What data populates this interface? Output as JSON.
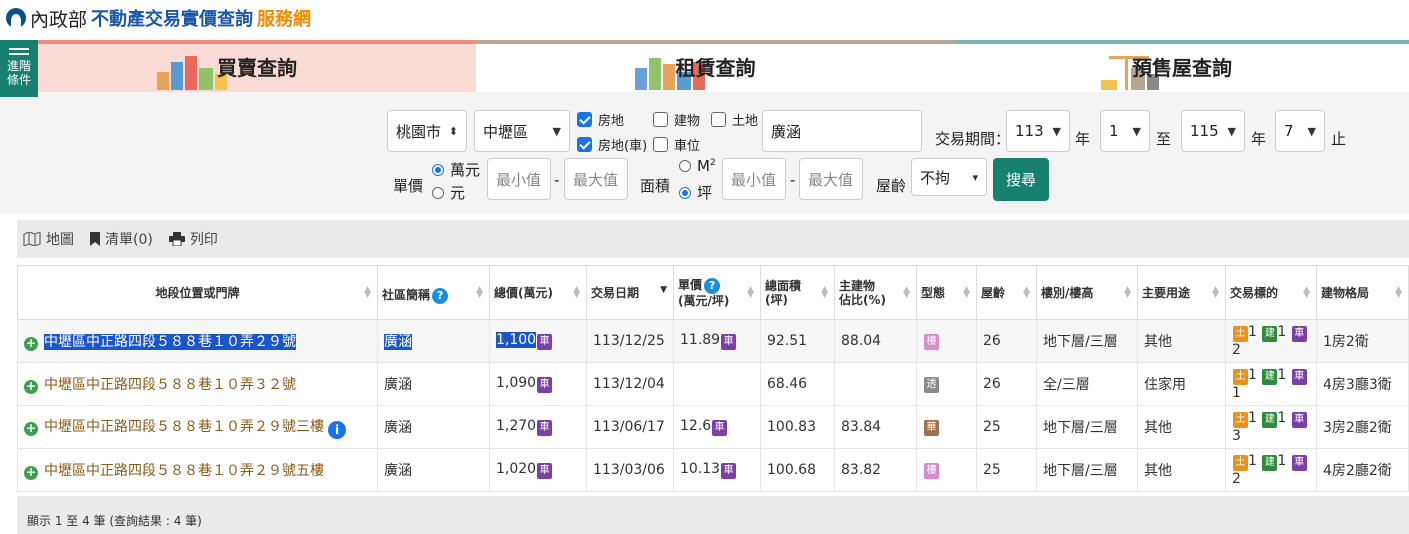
{
  "header": {
    "logo_min": "內政部",
    "title_main": "不動產交易實價查詢",
    "title_accent": "服務網"
  },
  "side_button": {
    "line1": "進階",
    "line2": "條件"
  },
  "tabs": [
    {
      "label": "買賣查詢",
      "active": true
    },
    {
      "label": "租賃查詢",
      "active": false
    },
    {
      "label": "預售屋查詢",
      "active": false
    }
  ],
  "filter": {
    "city": "桃園市",
    "district": "中壢區",
    "checkboxes": {
      "house_land": "房地",
      "building": "建物",
      "land": "土地",
      "house_land_car": "房地(車)",
      "parking": "車位"
    },
    "community_value": "廣涵",
    "period_label": "交易期間：",
    "from_year": "113",
    "year_label": "年",
    "from_month": "1",
    "to_label": "至",
    "to_year": "115",
    "year_label2": "年",
    "to_month": "7",
    "end_label": "止",
    "unit_price_label": "單價",
    "unit_wan": "萬元",
    "unit_yuan": "元",
    "min_placeholder": "最小值",
    "max_placeholder": "最大值",
    "dash": "-",
    "area_label": "面積",
    "area_m2": "M",
    "area_m2_sup": "2",
    "area_ping": "坪",
    "min_placeholder2": "最小值",
    "max_placeholder2": "最大值",
    "dash2": "-",
    "age_label": "屋齡",
    "age_value": "不拘",
    "search_label": "搜尋"
  },
  "toolbar": {
    "map": "地圖",
    "list": "清單(0)",
    "print": "列印"
  },
  "columns": {
    "address": "地段位置或門牌",
    "community": "社區簡稱",
    "total": "總價(萬元)",
    "date": "交易日期",
    "unit_a": "單價",
    "unit_b": "(萬元/坪)",
    "area_a": "總面積",
    "area_b": "(坪)",
    "ratio_a": "主建物",
    "ratio_b": "佔比(%)",
    "type": "型態",
    "age": "屋齡",
    "floor": "樓別/樓高",
    "use": "主要用途",
    "target": "交易標的",
    "layout": "建物格局"
  },
  "rows": [
    {
      "address": "中壢區中正路四段５８８巷１０弄２９號",
      "community": "廣涵",
      "total": "1,100",
      "date": "113/12/25",
      "unit": "11.89",
      "area": "92.51",
      "ratio": "88.04",
      "type": "樓",
      "age": "26",
      "floor": "地下層/三層",
      "use": "其他",
      "t1": "1",
      "t2": "1",
      "t3": "2",
      "layout": "1房2衛"
    },
    {
      "address": "中壢區中正路四段５８８巷１０弄３２號",
      "community": "廣涵",
      "total": "1,090",
      "date": "113/12/04",
      "unit": "",
      "area": "68.46",
      "ratio": "",
      "type": "透",
      "age": "26",
      "floor": "全/三層",
      "use": "住家用",
      "t1": "1",
      "t2": "1",
      "t3": "1",
      "layout": "4房3廳3衛"
    },
    {
      "address": "中壢區中正路四段５８８巷１０弄２９號三樓",
      "community": "廣涵",
      "total": "1,270",
      "date": "113/06/17",
      "unit": "12.6",
      "area": "100.83",
      "ratio": "83.84",
      "type": "華",
      "age": "25",
      "floor": "地下層/三層",
      "use": "其他",
      "t1": "1",
      "t2": "1",
      "t3": "3",
      "layout": "3房2廳2衛"
    },
    {
      "address": "中壢區中正路四段５８８巷１０弄２９號五樓",
      "community": "廣涵",
      "total": "1,020",
      "date": "113/03/06",
      "unit": "10.13",
      "area": "100.68",
      "ratio": "83.82",
      "type": "樓",
      "age": "25",
      "floor": "地下層/三層",
      "use": "其他",
      "t1": "1",
      "t2": "1",
      "t3": "2",
      "layout": "4房2廳2衛"
    }
  ],
  "tags": {
    "car": "車",
    "land": "土",
    "build": "建",
    "info": "i",
    "help": "?"
  },
  "type_colors": {
    "樓": "#d98bd0",
    "透": "#8a8a8a",
    "華": "#a0704a"
  },
  "footer": "顯示 1 至 4 筆 (查詢結果 : 4 筆)"
}
